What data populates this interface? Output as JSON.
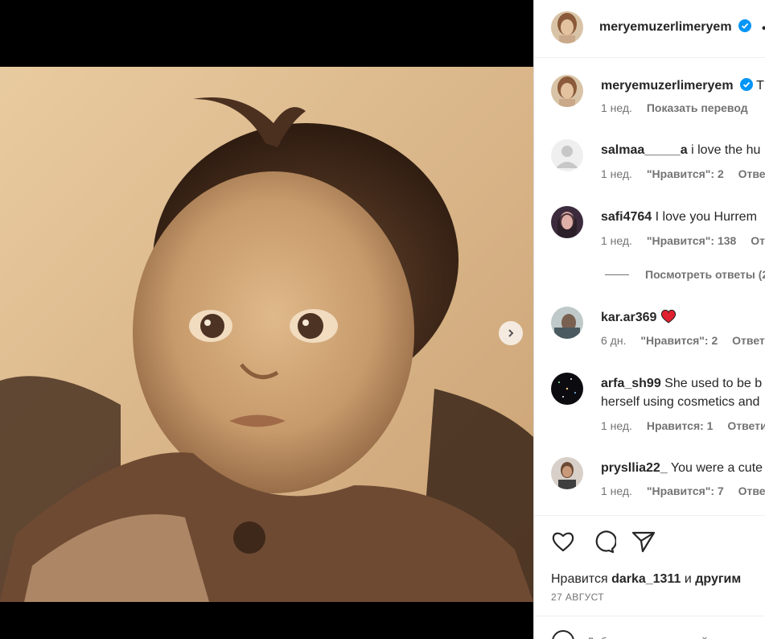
{
  "post": {
    "author": "meryemuzerlimeryem",
    "more_icon": "more-horizontal-icon",
    "caption_time": "1 нед.",
    "caption_translate": "Показать перевод",
    "caption_start": "T"
  },
  "comments": [
    {
      "user": "salmaa_____a",
      "text": "i love the hu",
      "time": "1 нед.",
      "likes": "\"Нравится\": 2",
      "reply": "Ответ"
    },
    {
      "user": "safi4764",
      "text": "I love you Hurrem",
      "time": "1 нед.",
      "likes": "\"Нравится\": 138",
      "reply": "Отв"
    },
    {
      "user": "kar.ar369",
      "text": "",
      "time": "6 дн.",
      "likes": "\"Нравится\": 2",
      "reply": "Ответи"
    },
    {
      "user": "arfa_sh99",
      "text": "She used to be b",
      "text2": "herself using cosmetics and",
      "time": "1 нед.",
      "likes": "Нравится: 1",
      "reply": "Ответит"
    },
    {
      "user": "prysllia22_",
      "text": "You were a cute",
      "time": "1 нед.",
      "likes": "\"Нравится\": 7",
      "reply": "Ответ"
    }
  ],
  "view_replies": "Посмотреть ответы (2",
  "actions": {
    "like_icon": "heart-icon",
    "comment_icon": "comment-icon",
    "share_icon": "send-icon"
  },
  "likes": {
    "prefix": "Нравится",
    "user": "darka_1311",
    "conj": "и",
    "others": "другим"
  },
  "date": "27 АВГУСТ",
  "add_comment": {
    "placeholder": "Добавьте комментарий..."
  },
  "colors": {
    "verified": "#0095f6",
    "heart": "#ed4956",
    "meta": "#737373"
  }
}
